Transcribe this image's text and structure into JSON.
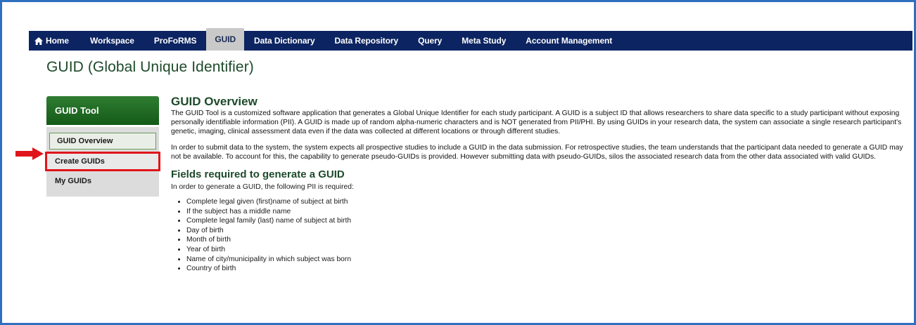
{
  "nav": {
    "items": [
      "Home",
      "Workspace",
      "ProFoRMS",
      "GUID",
      "Data Dictionary",
      "Data Repository",
      "Query",
      "Meta Study",
      "Account Management"
    ],
    "active": "GUID"
  },
  "page_title": "GUID (Global Unique Identifier)",
  "sidebar": {
    "title": "GUID Tool",
    "items": [
      "GUID Overview",
      "Create GUIDs",
      "My GUIDs"
    ]
  },
  "main": {
    "overview_heading": "GUID Overview",
    "overview_p1": "The GUID Tool is a customized software application that generates a Global Unique Identifier for each study participant. A GUID is a subject ID that allows researchers to share data specific to a study participant without exposing personally identifiable information (PII). A GUID is made up of random alpha-numeric characters and is NOT generated from PII/PHI. By using GUIDs in your research data, the system can associate a single research participant's genetic, imaging, clinical assessment data even if the data was collected at different locations or through different studies.",
    "overview_p2": "In order to submit data to the system, the system expects all prospective studies to include a GUID in the data submission. For retrospective studies, the team understands that the participant data needed to generate a GUID may not be available. To account for this, the capability to generate pseudo-GUIDs is provided. However submitting data with pseudo-GUIDs, silos the associated research data from the other data associated with valid GUIDs.",
    "fields_heading": "Fields required to generate a GUID",
    "fields_intro": "In order to generate a GUID, the following PII is required:",
    "fields": [
      "Complete legal given (first)name of subject at birth",
      "If the subject has a middle name",
      "Complete legal family (last) name of subject at birth",
      "Day of birth",
      "Month of birth",
      "Year of birth",
      "Name of city/municipality in which subject was born",
      "Country of birth"
    ]
  },
  "colors": {
    "nav_bg": "#0c2461",
    "sidebar_head": "#2f7d32",
    "highlight": "#e0151b",
    "heading": "#1d4a2a"
  }
}
